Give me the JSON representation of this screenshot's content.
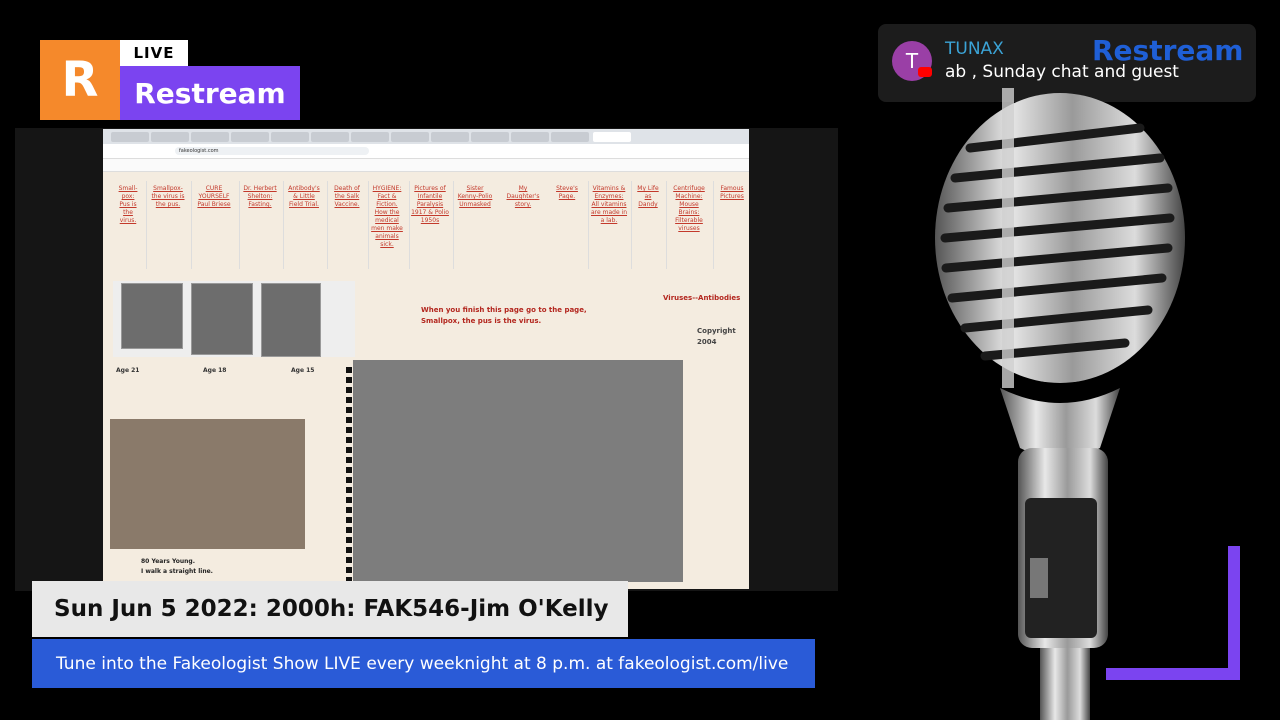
{
  "badge": {
    "letter": "R",
    "live": "LIVE",
    "name": "Restream"
  },
  "chat": {
    "avatar_letter": "T",
    "author": "TUNAX",
    "message": "ab , Sunday chat and guest",
    "logo": "Restream"
  },
  "browser": {
    "url": "fakeologist.com",
    "nav_links": [
      "Small-pox: Pus is the virus.",
      "Smallpox-the virus is the pus.",
      "CURE YOURSELF Paul Briese",
      "Dr. Herbert Shelton: Fasting.",
      "Antibody's & Little Field Trial.",
      "Death of the Salk Vaccine.",
      "HYGIENE: Fact & Fiction. How the medical men make animals sick.",
      "Pictures of Infantile Paralysis 1917 & Polio 1950s",
      "Sister Kenny-Polio Unmasked",
      "My Daughter's story.",
      "Steve's Page.",
      "Vitamins & Enzymes: All vitamins are made in a lab.",
      "My Life as Dandy",
      "Centrifuge Machine: Mouse Brains: Filterable viruses",
      "Famous Pictures"
    ],
    "photo_captions": [
      "Age 21",
      "Age 18",
      "Age 15"
    ],
    "notice": "When you finish this page go to the page, Smallpox, the pus is the virus.",
    "viruses_link": "Viruses--Antibodies",
    "copyright": "Copyright 2004",
    "man_caption_line1": "80 Years Young.",
    "man_caption_line2": "I walk a straight line."
  },
  "title": "Sun Jun 5 2022: 2000h: FAK546-Jim O'Kelly",
  "ticker": "Tune into the Fakeologist Show LIVE every weeknight at 8 p.m. at fakeologist.com/live",
  "colors": {
    "accent": "#7b44f0",
    "orange": "#f5892b",
    "ticker_blue": "#2a5bd7"
  }
}
